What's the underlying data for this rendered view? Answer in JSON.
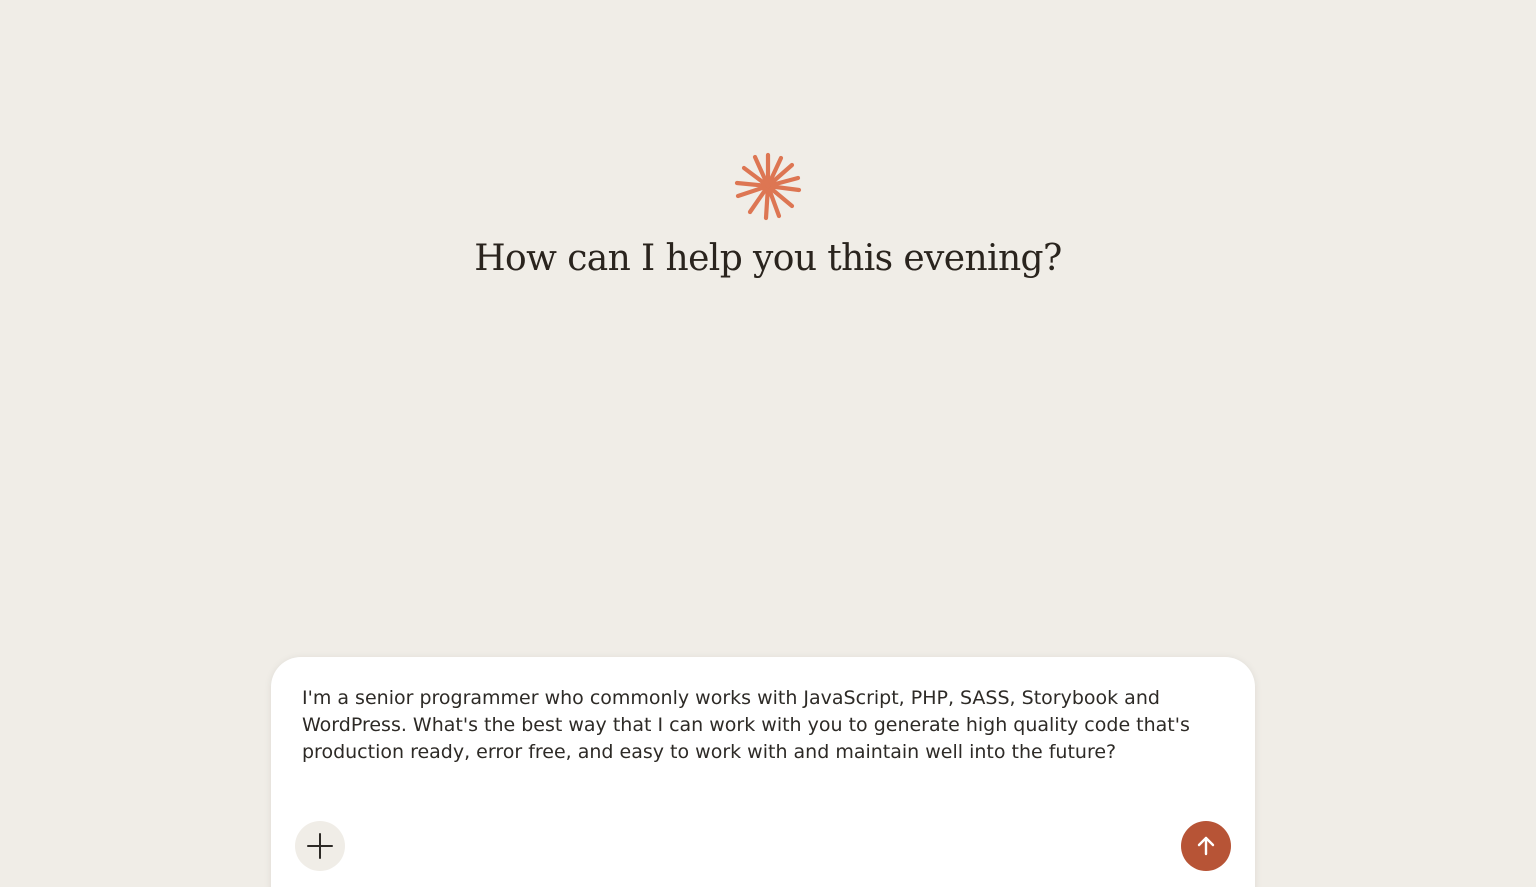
{
  "greeting": {
    "title": "How can I help you this evening?",
    "logo_icon": "sparkle-asterisk-icon",
    "accent_color": "#dd7653"
  },
  "composer": {
    "message": "I'm a senior programmer who commonly works with JavaScript, PHP, SASS, Storybook and WordPress. What's the best way that I can work with you to generate high quality code that's production ready, error free, and easy to work with and maintain well into the future?",
    "add_icon": "plus-icon",
    "send_icon": "arrow-up-icon",
    "send_color": "#b75436"
  }
}
